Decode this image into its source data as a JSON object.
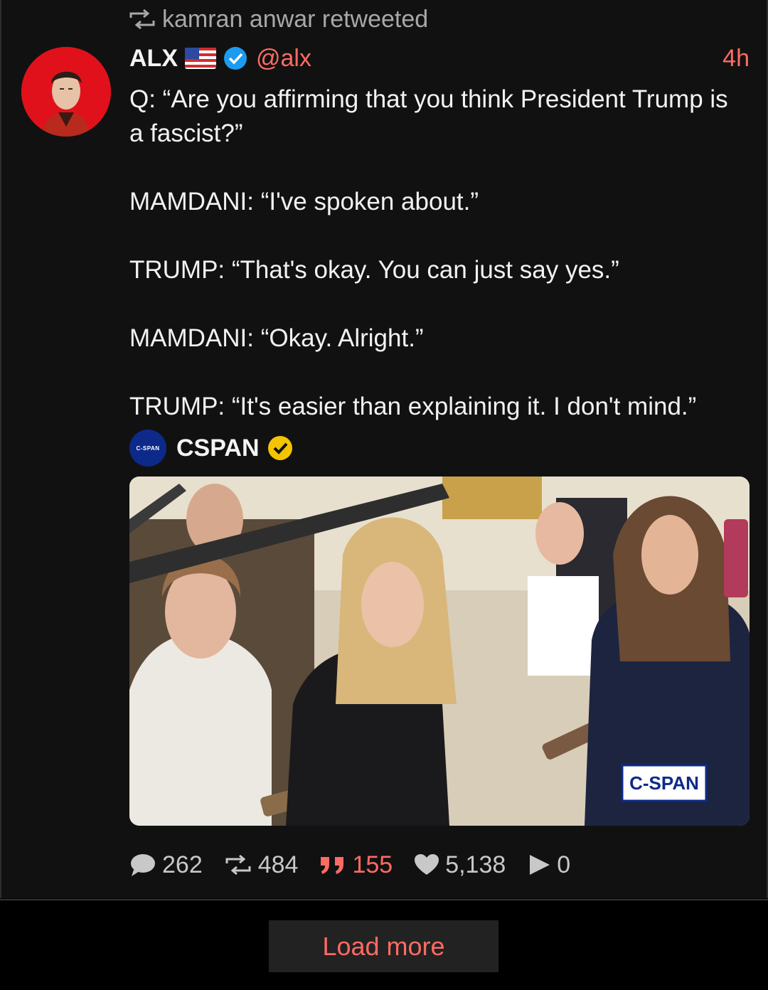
{
  "retweet": {
    "icon": "retweet-icon",
    "text": "kamran anwar retweeted"
  },
  "tweet": {
    "author_name": "ALX",
    "flag": "us-flag-icon",
    "verified_color": "#1d9bf0",
    "handle": "@alx",
    "time": "4h",
    "lines": [
      "Q: “Are you affirming that you think President Trump is a fascist?”",
      "MAMDANI: “I've spoken about.”",
      "TRUMP: “That's okay. You can just say yes.”",
      "MAMDANI: “Okay. Alright.”",
      "TRUMP: “It's easier than explaining it. I don't mind.”"
    ],
    "quoted": {
      "avatar_text": "C-SPAN",
      "name": "CSPAN",
      "badge_color": "#f5c400"
    },
    "media": {
      "watermark": "C-SPAN"
    }
  },
  "stats": {
    "replies": "262",
    "retweets": "484",
    "quotes": "155",
    "likes": "5,138",
    "views": "0"
  },
  "load_more_label": "Load more",
  "colors": {
    "accent": "#ff6b63",
    "background": "#111111"
  }
}
